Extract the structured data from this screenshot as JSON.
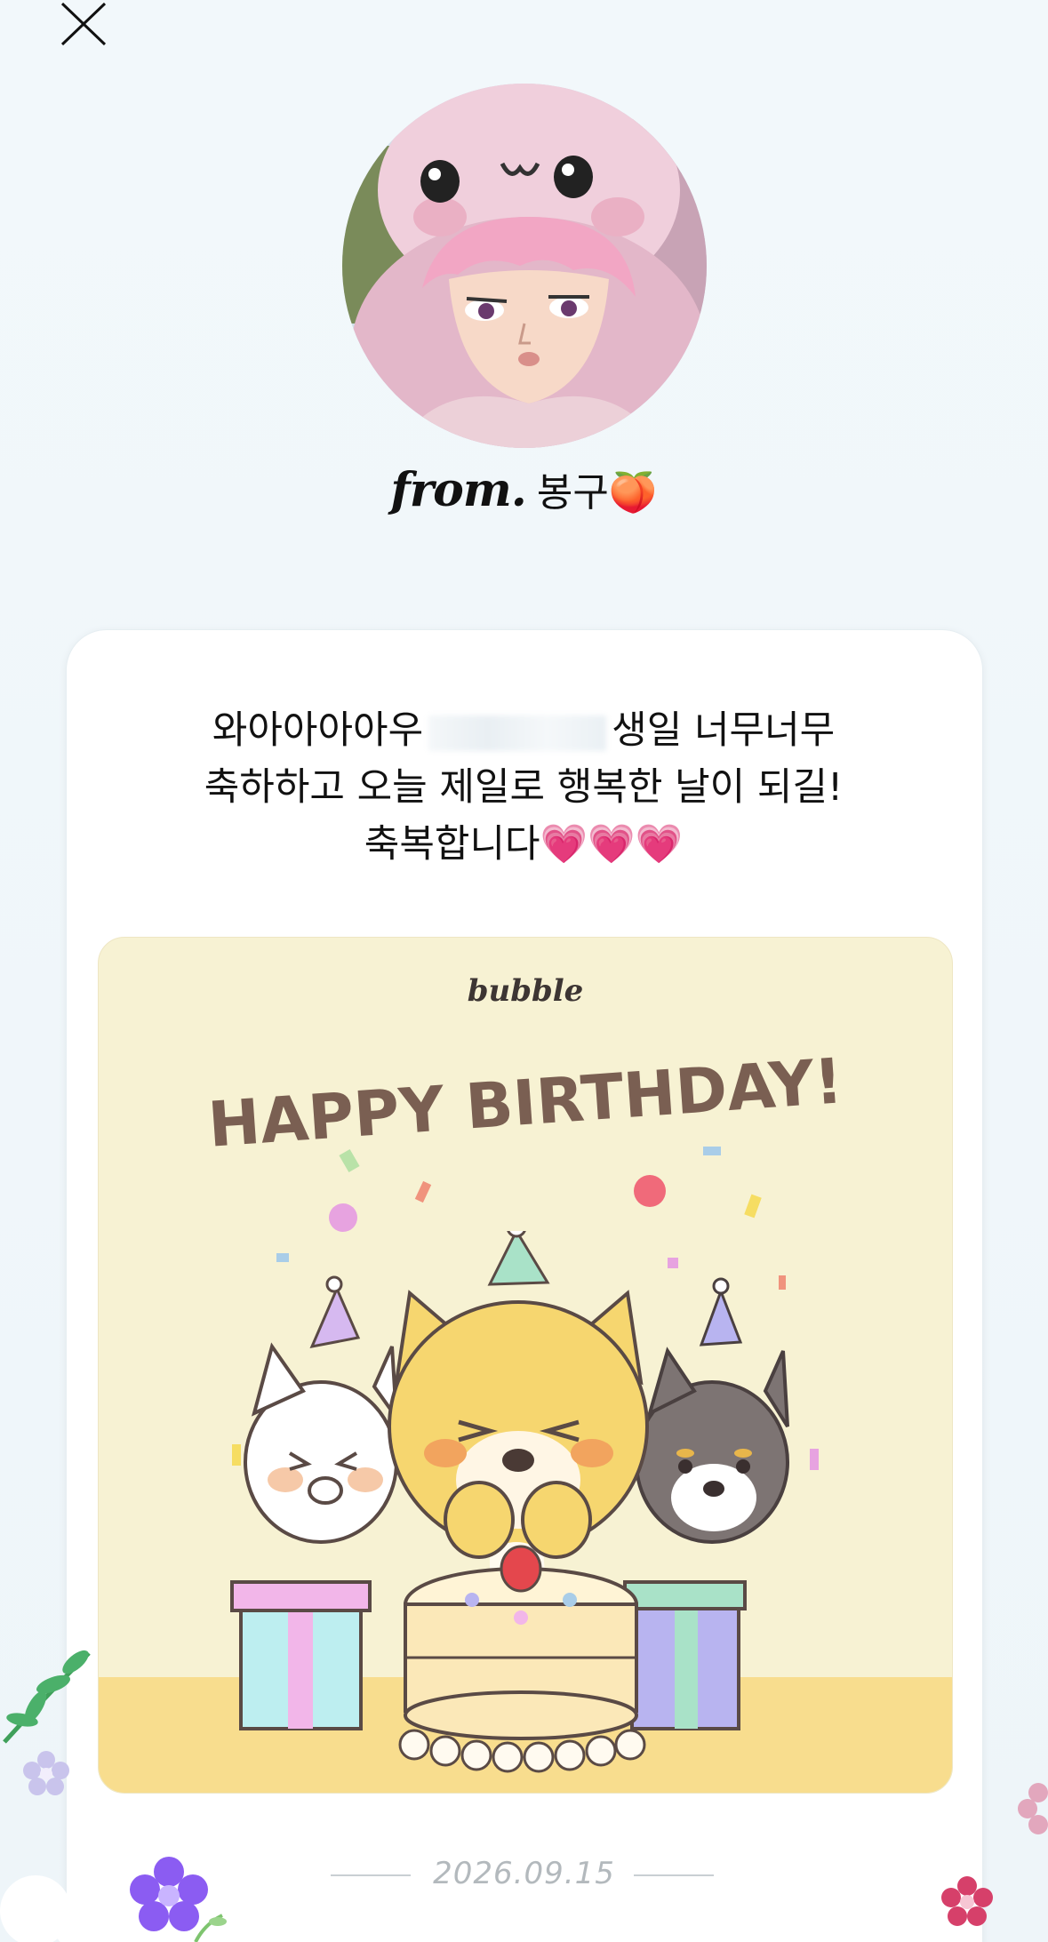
{
  "header": {
    "close_label": "close"
  },
  "sender": {
    "prefix": "from.",
    "name": "봉구",
    "emoji": "🍑"
  },
  "message": {
    "line1_before": "와아아아아우",
    "line1_after": "생일 너무너무",
    "line2": "축하하고 오늘 제일로 행복한 날이 되길!",
    "line3": "축복합니다💗💗💗"
  },
  "card_image": {
    "brand": "bubble",
    "headline": "HAPPY BIRTHDAY!"
  },
  "footer": {
    "date": "2026.09.15"
  },
  "colors": {
    "background": "#eef5f9",
    "card": "#ffffff",
    "image_bg": "#f7f2d3",
    "headline": "#7a5f52",
    "date": "#b3b9bd"
  }
}
